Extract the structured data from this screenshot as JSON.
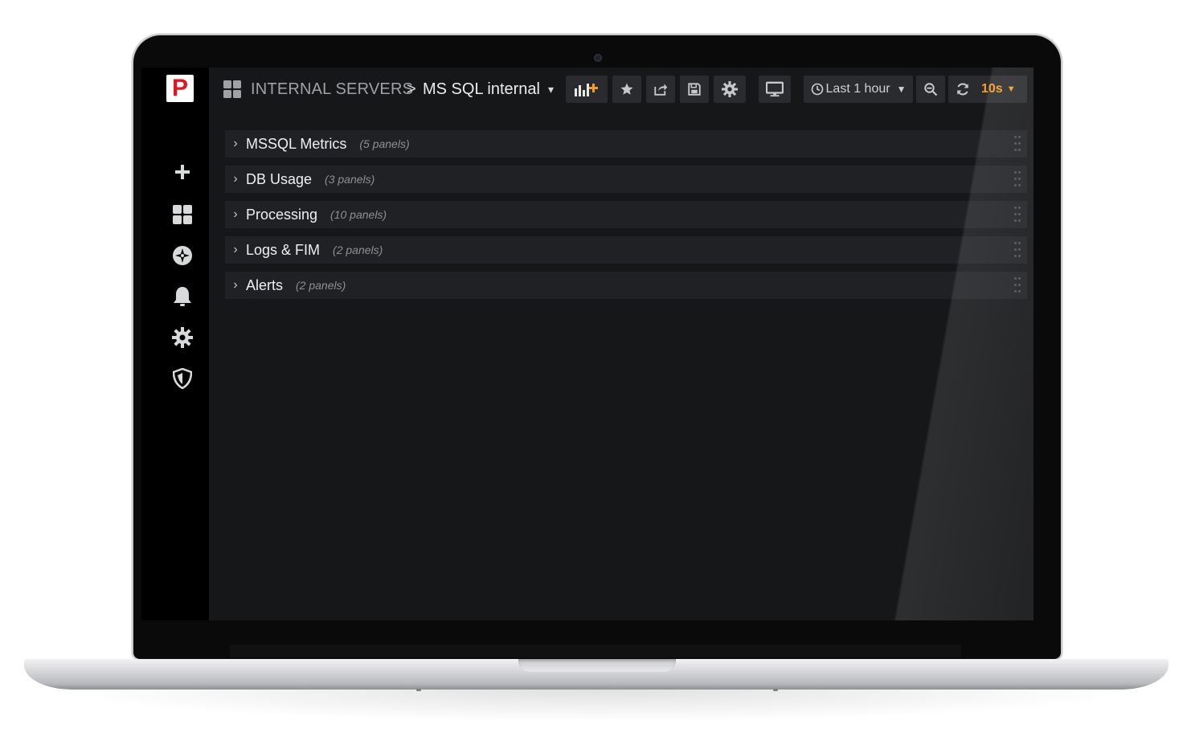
{
  "app": {
    "logo_letter": "P",
    "brand_color": "#e0151f",
    "accent_color": "#f89c24"
  },
  "sidebar": {
    "items": [
      {
        "icon": "plus-icon"
      },
      {
        "icon": "dashboards-grid-icon"
      },
      {
        "icon": "compass-icon"
      },
      {
        "icon": "bell-icon"
      },
      {
        "icon": "gear-icon"
      },
      {
        "icon": "shield-icon"
      }
    ]
  },
  "breadcrumb": {
    "folder": "INTERNAL SERVERS",
    "separator": ">",
    "title": "MS SQL internal",
    "caret": "▾"
  },
  "toolbar": {
    "buttons": [
      "add-panel-icon",
      "star-icon",
      "share-icon",
      "save-icon",
      "settings-icon",
      "tv-mode-icon"
    ],
    "time_range": "Last 1 hour",
    "refresh_interval": "10s"
  },
  "rows": [
    {
      "title": "MSSQL Metrics",
      "count": "(5 panels)"
    },
    {
      "title": "DB Usage",
      "count": "(3 panels)"
    },
    {
      "title": "Processing",
      "count": "(10 panels)"
    },
    {
      "title": "Logs & FIM",
      "count": "(2 panels)"
    },
    {
      "title": "Alerts",
      "count": "(2 panels)"
    }
  ]
}
